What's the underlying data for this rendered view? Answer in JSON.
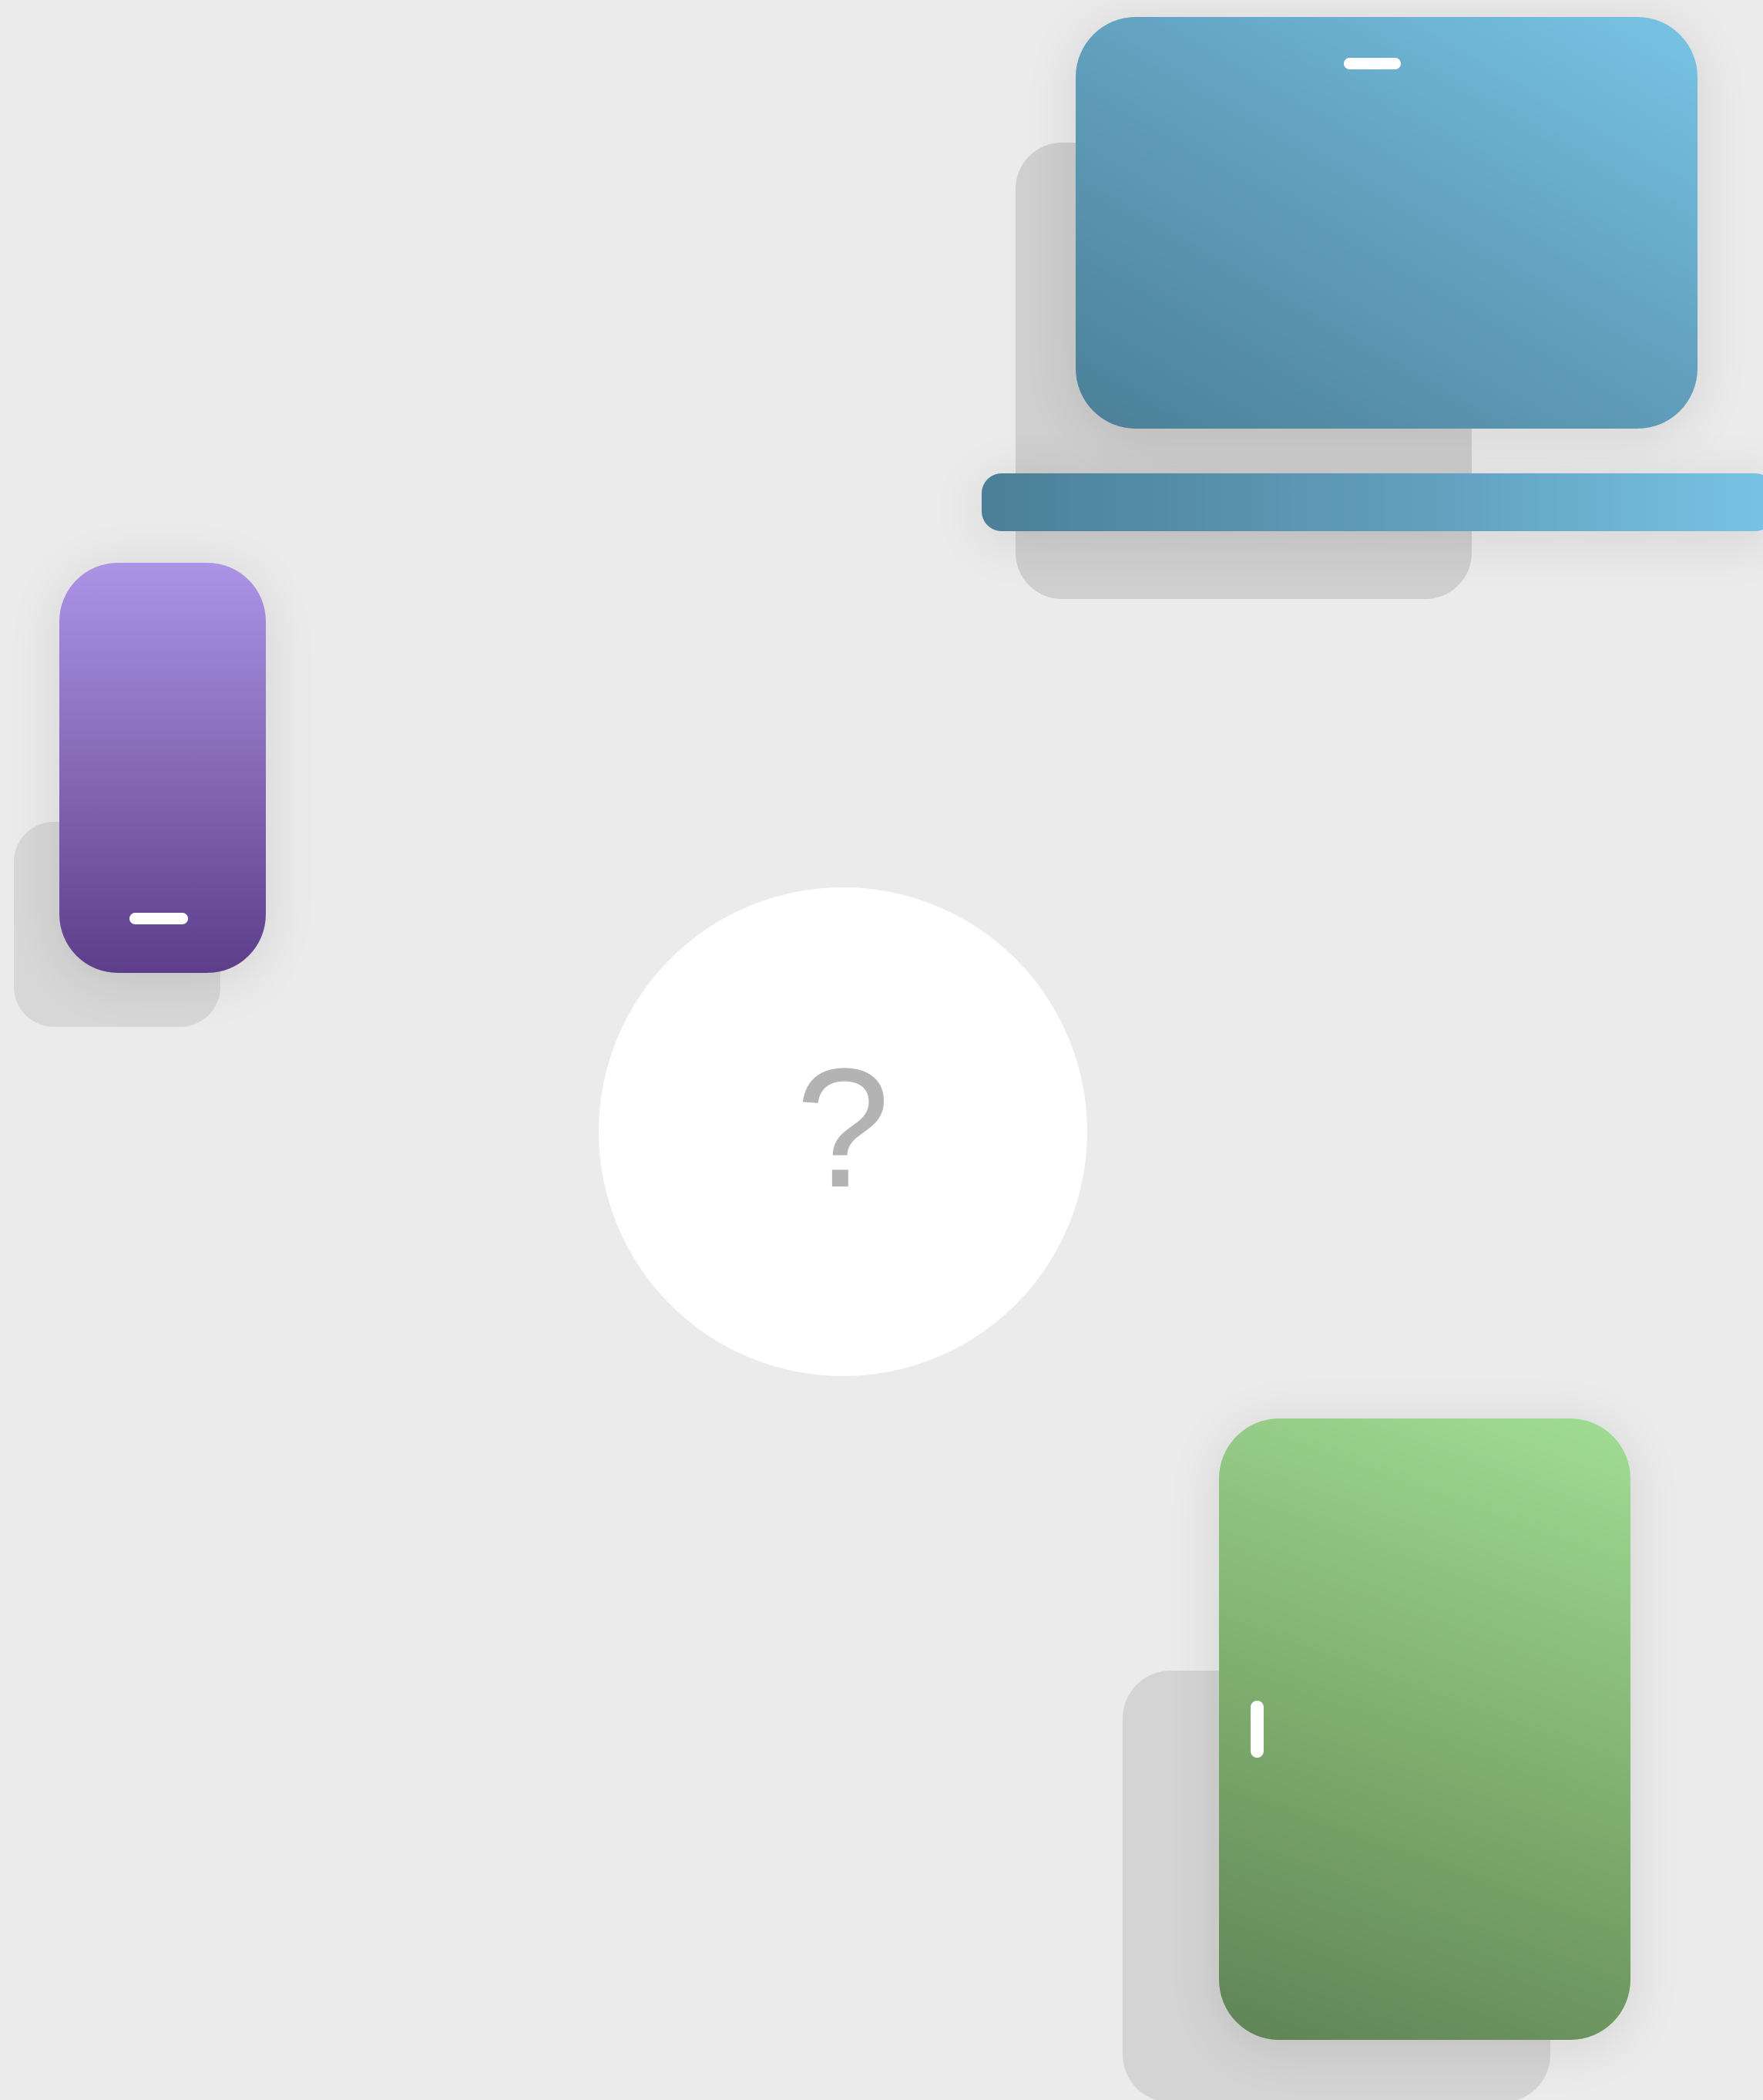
{
  "colors": {
    "background": "#ebebeb",
    "laptop_start": "#4b7f97",
    "laptop_end": "#78c4e6",
    "phone_top": "#ac93e6",
    "phone_bottom": "#5c3e8b",
    "tablet_top": "#a1dd95",
    "tablet_bottom": "#5f8356",
    "question_mark": "#b3b3b3"
  },
  "devices": {
    "laptop": {
      "icon": "laptop-icon"
    },
    "phone": {
      "icon": "smartphone-icon"
    },
    "tablet": {
      "icon": "tablet-icon"
    }
  },
  "center": {
    "icon": "question-mark-icon",
    "symbol": "?"
  }
}
